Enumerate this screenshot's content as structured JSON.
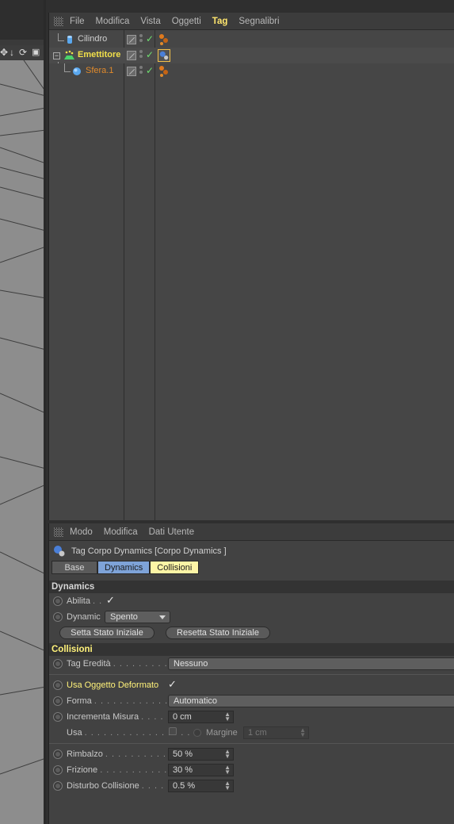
{
  "viewport": {
    "toolbar_icons": [
      "move-arrows-icon",
      "down-arrow-icon",
      "rotate-icon",
      "layout-icon"
    ]
  },
  "object_manager": {
    "menu": [
      "File",
      "Modifica",
      "Vista",
      "Oggetti",
      "Tag",
      "Segnalibri"
    ],
    "active_menu": "Tag",
    "objects": [
      {
        "name": "Cilindro",
        "color": "white",
        "icon": "cylinder-icon"
      },
      {
        "name": "Emettitore",
        "color": "yellow",
        "icon": "emitter-icon"
      },
      {
        "name": "Sfera.1",
        "color": "orange",
        "icon": "sphere-icon"
      }
    ]
  },
  "attribute_manager": {
    "menu": [
      "Modo",
      "Modifica",
      "Dati Utente"
    ],
    "title": "Tag Corpo Dynamics [Corpo Dynamics ]",
    "tabs": [
      "Base",
      "Dynamics",
      "Collisioni"
    ],
    "dynamics": {
      "header": "Dynamics",
      "abilita_label": "Abilita",
      "abilita_dots": ". .",
      "abilita_checked": true,
      "dynamic_label": "Dynamic",
      "dynamic_value": "Spento",
      "btn_set": "Setta Stato Iniziale",
      "btn_reset": "Resetta Stato Iniziale"
    },
    "collisioni": {
      "header": "Collisioni",
      "tag_ereditata_label": "Tag Eredità",
      "tag_ereditata_dots": ". . . . . . . . . .",
      "tag_ereditata_value": "Nessuno",
      "usa_oggetto_label": "Usa Oggetto Deformato",
      "usa_oggetto_checked": true,
      "forma_label": "Forma",
      "forma_dots": ". . . . . . . . . . . . . . . .",
      "forma_value": "Automatico",
      "incrementa_label": "Incrementa Misura",
      "incrementa_dots": ". . . .",
      "incrementa_value": "0 cm",
      "usa_label": "Usa",
      "usa_dots": ". . . . . . . . . . . . . . . . .",
      "margine_label": "Margine",
      "margine_value": "1 cm",
      "rimbalzo_label": "Rimbalzo",
      "rimbalzo_dots": ". . . . . . . . . . . .",
      "rimbalzo_value": "50 %",
      "frizione_label": "Frizione",
      "frizione_dots": ". . . . . . . . . . . . . .",
      "frizione_value": "30 %",
      "disturbo_label": "Disturbo Collisione",
      "disturbo_dots": ". . . .",
      "disturbo_value": "0.5 %"
    }
  }
}
